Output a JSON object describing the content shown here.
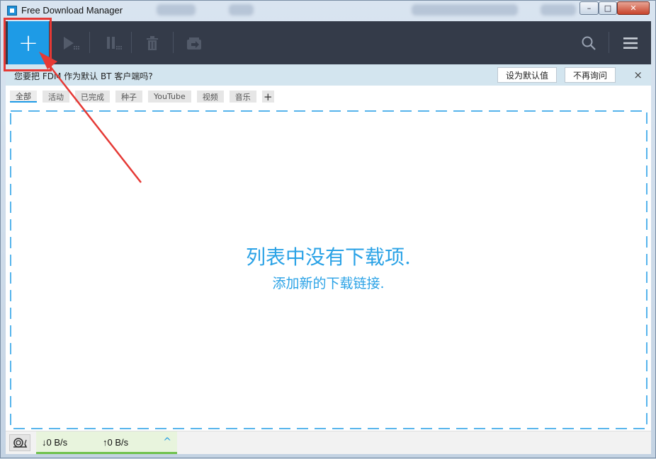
{
  "window": {
    "title": "Free Download Manager",
    "minimize": "–",
    "maximize": "□",
    "close": "✕"
  },
  "toolbar": {
    "add_label": "+",
    "icons": [
      "plus-icon",
      "play-icon",
      "pause-icon",
      "trash-icon",
      "move-icon",
      "search-icon",
      "menu-icon"
    ]
  },
  "notice": {
    "text": "您要把 FDM 作为默认 BT 客户端吗?",
    "set_default": "设为默认值",
    "dont_ask": "不再询问",
    "close": "×"
  },
  "tabs": [
    {
      "label": "全部",
      "active": true
    },
    {
      "label": "活动"
    },
    {
      "label": "已完成"
    },
    {
      "label": "种子"
    },
    {
      "label": "YouTube"
    },
    {
      "label": "视频"
    },
    {
      "label": "音乐"
    }
  ],
  "tab_add": "+",
  "empty": {
    "title": "列表中没有下载项.",
    "subtitle": "添加新的下载链接."
  },
  "status": {
    "download": "↓0 B/s",
    "upload": "↑0 B/s",
    "expand": "^"
  },
  "colors": {
    "accent": "#1e9be6",
    "toolbar_bg": "#343b49",
    "annotation": "#e53935"
  }
}
